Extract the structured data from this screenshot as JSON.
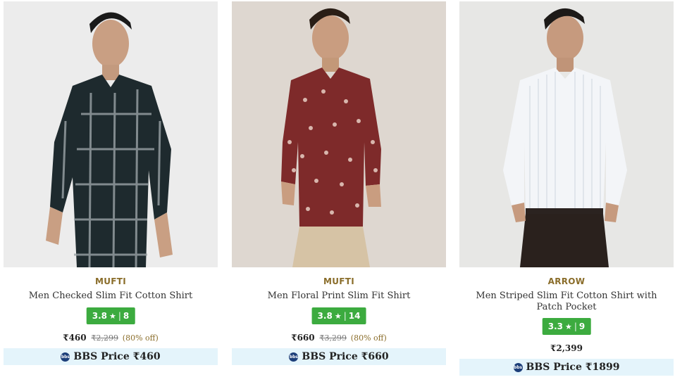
{
  "products": [
    {
      "brand": "MUFTI",
      "name": "Men Checked Slim Fit Cotton Shirt",
      "rating": "3.8",
      "rating_count": "8",
      "price": "₹460",
      "mrp": "₹2,299",
      "discount": "(80% off)",
      "bbs_label": "BBS Price ₹460",
      "bg_color": "#ececec",
      "shirt_color": "#1e2a2e"
    },
    {
      "brand": "MUFTI",
      "name": "Men Floral Print Slim Fit Shirt",
      "rating": "3.8",
      "rating_count": "14",
      "price": "₹660",
      "mrp": "₹3,299",
      "discount": "(80% off)",
      "bbs_label": "BBS Price ₹660",
      "bg_color": "#ded7d0",
      "shirt_color": "#7e2a2a"
    },
    {
      "brand": "ARROW",
      "name": "Men Striped Slim Fit Cotton Shirt with Patch Pocket",
      "rating": "3.3",
      "rating_count": "9",
      "price": "₹2,399",
      "bbs_label": "BBS Price ₹1899",
      "bg_color": "#e7e7e5",
      "shirt_color": "#f3f5f8"
    }
  ],
  "colors": {
    "rating_badge": "#3cab3f",
    "brand_text": "#8a6d2a",
    "bbs_bar": "#e4f4fb",
    "bbs_icon": "#1c3e79"
  },
  "icons": {
    "star": "★",
    "bbs_icon_text": "bbs"
  }
}
